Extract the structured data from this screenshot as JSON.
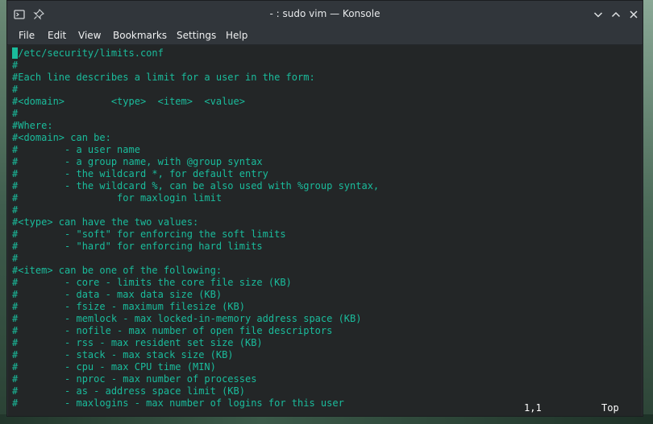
{
  "window": {
    "title": "- : sudo vim — Konsole"
  },
  "menubar": {
    "items": [
      "File",
      "Edit",
      "View",
      "Bookmarks",
      "Settings",
      "Help"
    ]
  },
  "editor": {
    "lines": [
      " /etc/security/limits.conf",
      "#",
      "#Each line describes a limit for a user in the form:",
      "#",
      "#<domain>        <type>  <item>  <value>",
      "#",
      "#Where:",
      "#<domain> can be:",
      "#        - a user name",
      "#        - a group name, with @group syntax",
      "#        - the wildcard *, for default entry",
      "#        - the wildcard %, can be also used with %group syntax,",
      "#                 for maxlogin limit",
      "#",
      "#<type> can have the two values:",
      "#        - \"soft\" for enforcing the soft limits",
      "#        - \"hard\" for enforcing hard limits",
      "#",
      "#<item> can be one of the following:",
      "#        - core - limits the core file size (KB)",
      "#        - data - max data size (KB)",
      "#        - fsize - maximum filesize (KB)",
      "#        - memlock - max locked-in-memory address space (KB)",
      "#        - nofile - max number of open file descriptors",
      "#        - rss - max resident set size (KB)",
      "#        - stack - max stack size (KB)",
      "#        - cpu - max CPU time (MIN)",
      "#        - nproc - max number of processes",
      "#        - as - address space limit (KB)",
      "#        - maxlogins - max number of logins for this user"
    ],
    "status_position": "1,1",
    "status_scroll": "Top"
  },
  "colors": {
    "terminal_bg": "#232627",
    "text": "#1abc9c",
    "chrome": "#31363b"
  }
}
